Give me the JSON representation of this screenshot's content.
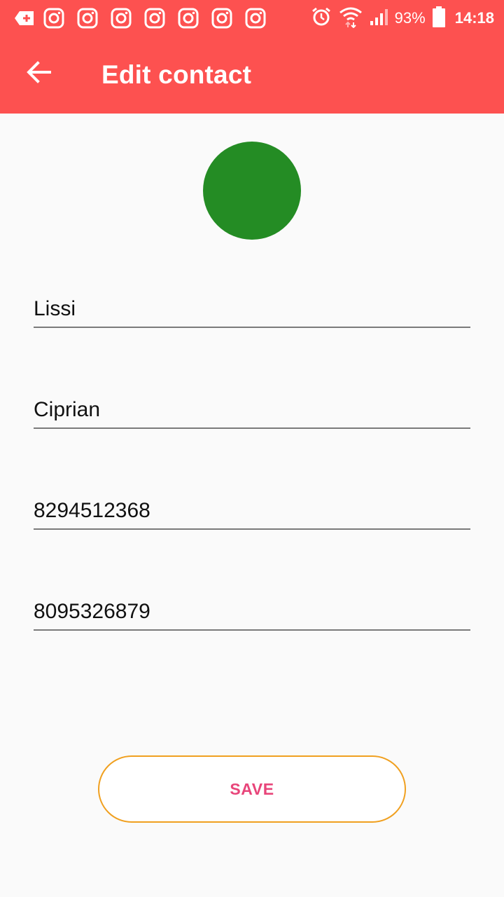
{
  "status_bar": {
    "notification_icons": [
      "message-plus-icon",
      "instagram-icon",
      "instagram-icon",
      "instagram-icon",
      "instagram-icon",
      "instagram-icon",
      "instagram-icon",
      "instagram-icon"
    ],
    "system_icons": [
      "alarm-icon",
      "wifi-icon",
      "signal-icon",
      "battery-icon"
    ],
    "battery_percent": "93%",
    "time": "14:18"
  },
  "toolbar": {
    "title": "Edit contact",
    "back_icon": "arrow-back-icon"
  },
  "colors": {
    "app_bar": "#fd5150",
    "avatar": "#248c24",
    "save_border": "#f0a020",
    "save_text": "#e8457a"
  },
  "form": {
    "first_name": "Lissi",
    "last_name": "Ciprian",
    "phone_1": "8294512368",
    "phone_2": "8095326879"
  },
  "actions": {
    "save_label": "SAVE"
  }
}
